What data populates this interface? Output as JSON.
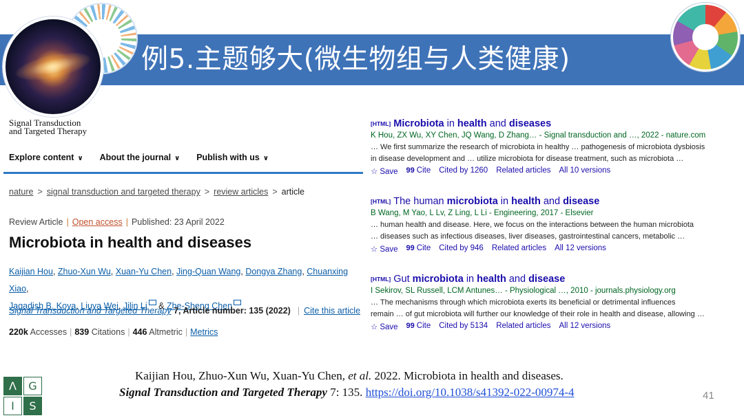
{
  "slide": {
    "title": "例5.主题够大(微生物组与人类健康)",
    "page_number": "41"
  },
  "article": {
    "journal_logo_line1": "Signal Transduction",
    "journal_logo_line2": "and Targeted Therapy",
    "nav": [
      "Explore content",
      "About the journal",
      "Publish with us"
    ],
    "breadcrumbs": [
      "nature",
      "signal transduction and targeted therapy",
      "review articles",
      "article"
    ],
    "type": "Review Article",
    "access": "Open access",
    "published": "Published: 23 April 2022",
    "title": "Microbiota in health and diseases",
    "authors_line1": [
      "Kaijian Hou",
      "Zhuo-Xun Wu",
      "Xuan-Yu Chen",
      "Jing-Quan Wang",
      "Dongya Zhang",
      "Chuanxing Xiao"
    ],
    "authors_line2": [
      "Jagadish B. Koya",
      "Liuya Wei",
      "Jilin Li"
    ],
    "author_last": "Zhe-Sheng Chen",
    "amp": "&",
    "journal": "Signal Transduction and Targeted Therapy",
    "volume_info": "7, Article number: 135 (2022)",
    "cite_label": "Cite this article",
    "accesses_num": "220k",
    "accesses_label": "Accesses",
    "citations_num": "839",
    "citations_label": "Citations",
    "altmetric_num": "446",
    "altmetric_label": "Altmetric",
    "metrics_label": "Metrics"
  },
  "results": [
    {
      "tag": "[HTML]",
      "title_parts": [
        "Microbiota",
        " in ",
        "health",
        " and ",
        "diseases"
      ],
      "authors": "K Hou, ZX Wu, XY Chen, JQ Wang, D Zhang… - Signal transduction and …, 2022 - nature.com",
      "snippet1": "… We first summarize the research of microbiota in healthy … pathogenesis of microbiota dysbiosis",
      "snippet2": "in disease development and … utilize microbiota for disease treatment, such as microbiota …",
      "save": "Save",
      "cite": "Cite",
      "cited_by": "Cited by 1260",
      "related": "Related articles",
      "versions": "All 10 versions"
    },
    {
      "tag": "[HTML]",
      "title_parts": [
        "The human ",
        "microbiota",
        " in ",
        "health",
        " and ",
        "disease"
      ],
      "authors": "B Wang, M Yao, L Lv, Z Ling, L Li - Engineering, 2017 - Elsevier",
      "snippet1": "… human health and disease. Here, we focus on the interactions between the human microbiota",
      "snippet2": "… diseases such as infectious diseases, liver diseases, gastrointestinal cancers, metabolic …",
      "save": "Save",
      "cite": "Cite",
      "cited_by": "Cited by 946",
      "related": "Related articles",
      "versions": "All 12 versions"
    },
    {
      "tag": "[HTML]",
      "title_parts": [
        "Gut ",
        "microbiota",
        " in ",
        "health",
        " and ",
        "disease"
      ],
      "authors": "I Sekirov, SL Russell, LCM Antunes… - Physiological …, 2010 - journals.physiology.org",
      "snippet1": "… The mechanisms through which microbiota exerts its beneficial or detrimental influences",
      "snippet2": "remain … of gut microbiota will further our knowledge of their role in health and disease, allowing …",
      "save": "Save",
      "cite": "Cite",
      "cited_by": "Cited by 5134",
      "related": "Related articles",
      "versions": "All 12 versions"
    }
  ],
  "reference": {
    "line1_a": "Kaijian Hou, Zhuo-Xun Wu, Xuan-Yu Chen",
    "line1_etal": ", et al.",
    "line1_b": " 2022. Microbiota in health and diseases.",
    "journal": "Signal Transduction and Targeted Therapy",
    "volume": " 7: 135. ",
    "doi": "https://doi.org/10.1038/s41392-022-00974-4"
  },
  "logo": {
    "cells": [
      "Λ",
      "G",
      "I",
      "S"
    ]
  },
  "colors": {
    "header_blue": "#3f73b8",
    "link_blue": "#1a0dab",
    "green_authors": "#006621",
    "accent_orange": "#c0512d"
  }
}
